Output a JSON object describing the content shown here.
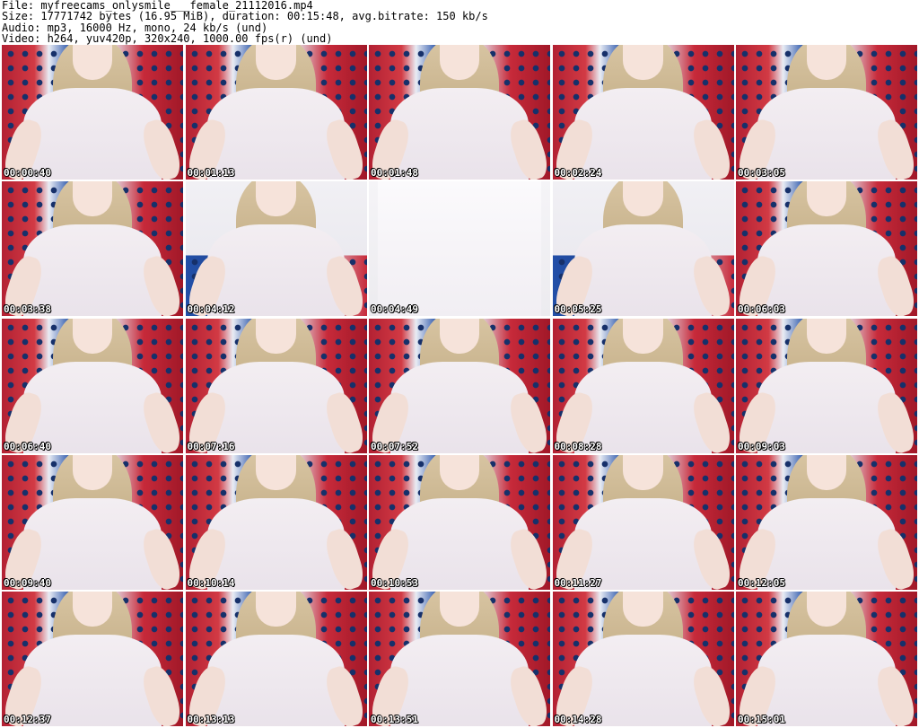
{
  "header": {
    "file_line": "File: myfreecams_onlysmile___female_21112016.mp4",
    "size_line": "Size: 17771742 bytes (16.95 MiB), duration: 00:15:48, avg.bitrate: 150 kb/s",
    "audio_line": "Audio: mp3, 16000 Hz, mono, 24 kb/s (und)",
    "video_line": "Video: h264, yuv420p, 320x240, 1000.00 fps(r) (und)"
  },
  "thumbnails": [
    {
      "timestamp": "00:00:40"
    },
    {
      "timestamp": "00:01:13"
    },
    {
      "timestamp": "00:01:48"
    },
    {
      "timestamp": "00:02:24"
    },
    {
      "timestamp": "00:03:05"
    },
    {
      "timestamp": "00:03:38"
    },
    {
      "timestamp": "00:04:12"
    },
    {
      "timestamp": "00:04:49"
    },
    {
      "timestamp": "00:05:25"
    },
    {
      "timestamp": "00:06:03"
    },
    {
      "timestamp": "00:06:40"
    },
    {
      "timestamp": "00:07:16"
    },
    {
      "timestamp": "00:07:52"
    },
    {
      "timestamp": "00:08:28"
    },
    {
      "timestamp": "00:09:03"
    },
    {
      "timestamp": "00:09:40"
    },
    {
      "timestamp": "00:10:14"
    },
    {
      "timestamp": "00:10:53"
    },
    {
      "timestamp": "00:11:27"
    },
    {
      "timestamp": "00:12:05"
    },
    {
      "timestamp": "00:12:37"
    },
    {
      "timestamp": "00:13:13"
    },
    {
      "timestamp": "00:13:51"
    },
    {
      "timestamp": "00:14:28"
    },
    {
      "timestamp": "00:15:01"
    }
  ]
}
